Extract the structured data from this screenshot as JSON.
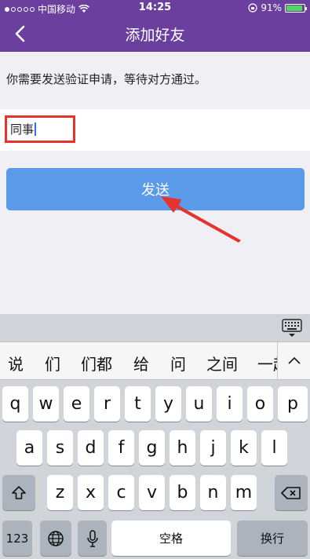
{
  "status": {
    "carrier": "中国移动",
    "time": "14:25",
    "battery": "91%",
    "battery_level": 0.91
  },
  "nav": {
    "title": "添加好友",
    "back_icon": "chevron-left-icon"
  },
  "form": {
    "hint": "你需要发送验证申请，等待对方通过。",
    "input_value": "同事"
  },
  "send_button": {
    "label": "发送"
  },
  "colors": {
    "nav": "#6b3f9e",
    "send": "#5b9ae8",
    "highlight": "#e8322e",
    "battery": "#4cd964"
  },
  "keyboard": {
    "candidates": [
      "说",
      "们",
      "们都",
      "给",
      "问",
      "之间",
      "一起"
    ],
    "row1": [
      "q",
      "w",
      "e",
      "r",
      "t",
      "y",
      "u",
      "i",
      "o",
      "p"
    ],
    "row2": [
      "a",
      "s",
      "d",
      "f",
      "g",
      "h",
      "j",
      "k",
      "l"
    ],
    "row3": [
      "z",
      "x",
      "c",
      "v",
      "b",
      "n",
      "m"
    ],
    "numbers": "123",
    "space": "空格",
    "return": "换行"
  }
}
